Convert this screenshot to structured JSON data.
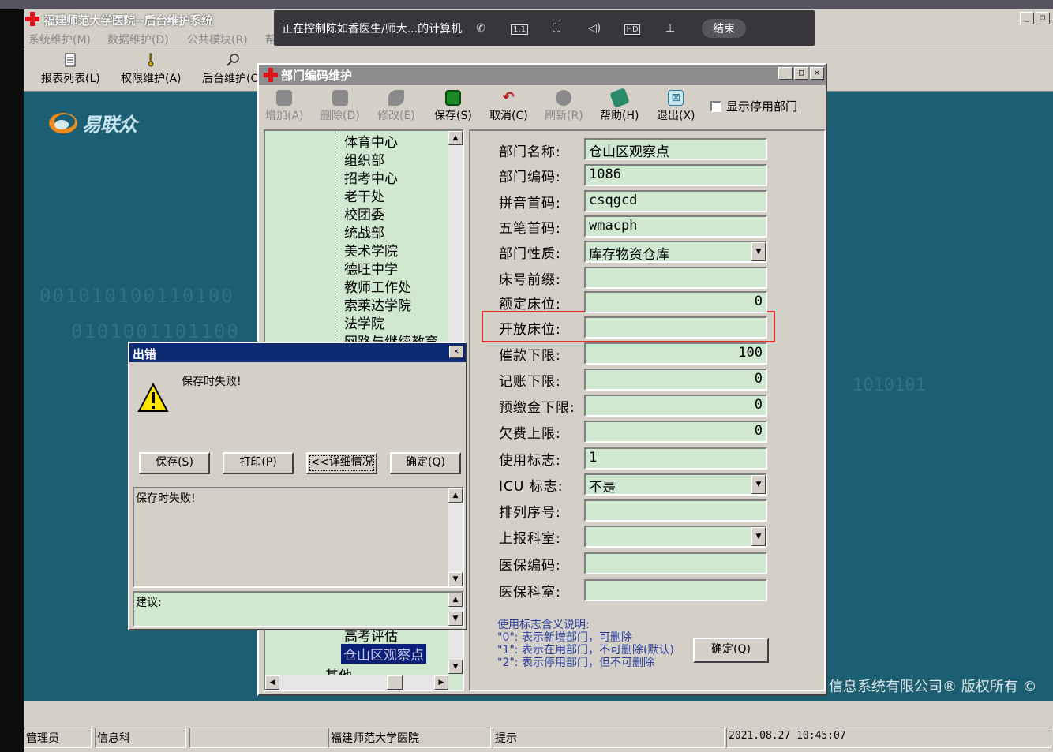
{
  "main": {
    "title": "福建师范大学医院--后台维护系统",
    "menus": [
      "系统维护(M)",
      "数据维护(D)",
      "公共模块(R)",
      "帮助(H)"
    ],
    "toolbar": [
      "报表列表(L)",
      "权限维护(A)",
      "后台维护(O)"
    ],
    "logo_text": "易联众",
    "desktop_bits_1": "001010100110100",
    "desktop_bits_2": "0101001101100",
    "desktop_bits_3": "1010101",
    "copyright": "信息系统有限公司® 版权所有 ©",
    "status": [
      "管理员",
      "信息科",
      "福建师范大学医院",
      "提示",
      "2021.08.27  10:45:07"
    ]
  },
  "remote": {
    "text": "正在控制陈如香医生/师大...的计算机",
    "end_label": "结束",
    "icons": [
      "phone-icon",
      "one-to-one-icon",
      "fullscreen-icon",
      "volume-icon",
      "hd-icon",
      "pin-icon"
    ],
    "hd": "HD",
    "ratio": "1:1"
  },
  "dept": {
    "title": "部门编码维护",
    "buttons": [
      "增加(A)",
      "删除(D)",
      "修改(E)",
      "保存(S)",
      "取消(C)",
      "刷新(R)",
      "帮助(H)",
      "退出(X)"
    ],
    "show_disabled_label": "显示停用部门",
    "tree": [
      "体育中心",
      "组织部",
      "招考中心",
      "老干处",
      "校团委",
      "统战部",
      "美术学院",
      "德旺中学",
      "教师工作处",
      "索莱达学院",
      "法学院",
      "网路与继续教育"
    ],
    "tree_partial": "高考评估",
    "tree_selected": "仓山区观察点",
    "tree_other": "其他",
    "fields": [
      {
        "label": "部门名称:",
        "value": "仓山区观察点"
      },
      {
        "label": "部门编码:",
        "value": "1086"
      },
      {
        "label": "拼音首码:",
        "value": "csqgcd"
      },
      {
        "label": "五笔首码:",
        "value": "wmacph"
      },
      {
        "label": "部门性质:",
        "value": "库存物资仓库"
      },
      {
        "label": "床号前缀:",
        "value": ""
      },
      {
        "label": "额定床位:",
        "value": "0"
      },
      {
        "label": "开放床位:",
        "value": ""
      },
      {
        "label": "催款下限:",
        "value": "100"
      },
      {
        "label": "记账下限:",
        "value": "0"
      },
      {
        "label": "预缴金下限:",
        "value": "0"
      },
      {
        "label": "欠费上限:",
        "value": "0"
      },
      {
        "label": "使用标志:",
        "value": "1"
      },
      {
        "label": "ICU 标志:",
        "value": "不是"
      },
      {
        "label": "排列序号:",
        "value": ""
      },
      {
        "label": "上报科室:",
        "value": ""
      },
      {
        "label": "医保编码:",
        "value": ""
      },
      {
        "label": "医保科室:",
        "value": ""
      }
    ],
    "notes": [
      "使用标志含义说明:",
      "\"0\": 表示新增部门，可删除",
      "\"1\": 表示在用部门，不可删除(默认)",
      "\"2\": 表示停用部门，但不可删除"
    ],
    "ok_label": "确定(Q)"
  },
  "error": {
    "title": "出错",
    "message": "保存时失败!",
    "buttons": [
      "保存(S)",
      "打印(P)",
      "<<详细情况",
      "确定(Q)"
    ],
    "detail": "保存时失败!",
    "suggestion": "建议:"
  }
}
